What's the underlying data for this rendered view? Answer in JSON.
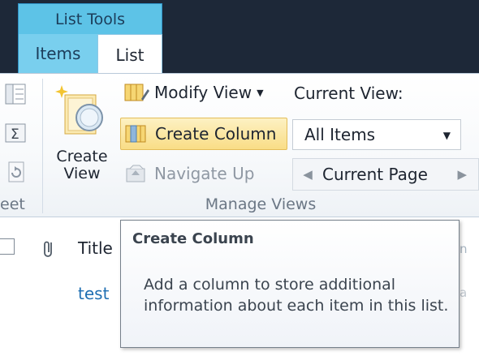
{
  "ribbon": {
    "context_group": "List Tools",
    "tabs": [
      {
        "label": "Items",
        "selected": false
      },
      {
        "label": "List",
        "selected": true
      }
    ],
    "left_group_label": "eet",
    "create_view_label": "Create\nView",
    "modify_view_label": "Modify View",
    "create_column_label": "Create Column",
    "navigate_up_label": "Navigate Up",
    "current_view_label": "Current View:",
    "current_view_value": "All Items",
    "current_page_label": "Current Page",
    "manage_views_label": "Manage Views"
  },
  "list": {
    "column_title": "Title",
    "rows": [
      "test"
    ],
    "edge_fragment_1": "n",
    "edge_fragment_2": "a"
  },
  "tooltip": {
    "title": "Create Column",
    "body": "Add a column to store additional information about each item in this list."
  },
  "colors": {
    "ribbon_dark": "#1d2838",
    "context_tab": "#5dc3e7",
    "highlight_button": "#f9dd86",
    "link": "#1f6fb2"
  },
  "icons": {
    "ribbon_left_1": "datasheet-view-icon",
    "ribbon_left_2": "totals-icon",
    "ribbon_left_3": "refresh-data-icon",
    "create_view": "create-view-icon",
    "modify_view": "modify-view-icon",
    "create_column": "create-column-icon",
    "navigate_up": "navigate-up-icon",
    "attachment": "paperclip-icon"
  }
}
